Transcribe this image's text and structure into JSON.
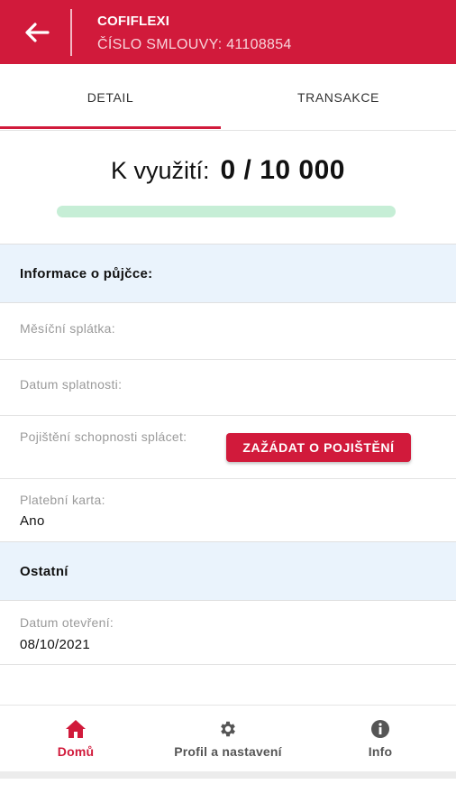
{
  "header": {
    "title": "COFIFLEXI",
    "contract": "ČÍSLO SMLOUVY: 41108854"
  },
  "tabs": [
    {
      "label": "DETAIL",
      "active": true
    },
    {
      "label": "TRANSAKCE",
      "active": false
    }
  ],
  "available": {
    "label": "K využití:",
    "value": "0 / 10 000",
    "progress_fraction": 0
  },
  "loan_info": {
    "heading": "Informace o půjčce:",
    "monthly_payment_label": "Měsíční splátka:",
    "due_date_label": "Datum splatnosti:",
    "insurance_label": "Pojištění schopnosti splácet:",
    "insurance_button": "ZAŽÁDAT O POJIŠTĚNÍ",
    "card_label": "Platební karta:",
    "card_value": "Ano"
  },
  "other": {
    "heading": "Ostatní",
    "opened_label": "Datum otevření:",
    "opened_value": "08/10/2021"
  },
  "bottom_nav": [
    {
      "label": "Domů",
      "icon": "home-icon",
      "active": true
    },
    {
      "label": "Profil a nastavení",
      "icon": "gear-icon",
      "active": false
    },
    {
      "label": "Info",
      "icon": "info-icon",
      "active": false
    }
  ],
  "colors": {
    "brand": "#d11a3b",
    "section_bg": "#eaf3fc",
    "progress_track": "#c6eed6"
  }
}
